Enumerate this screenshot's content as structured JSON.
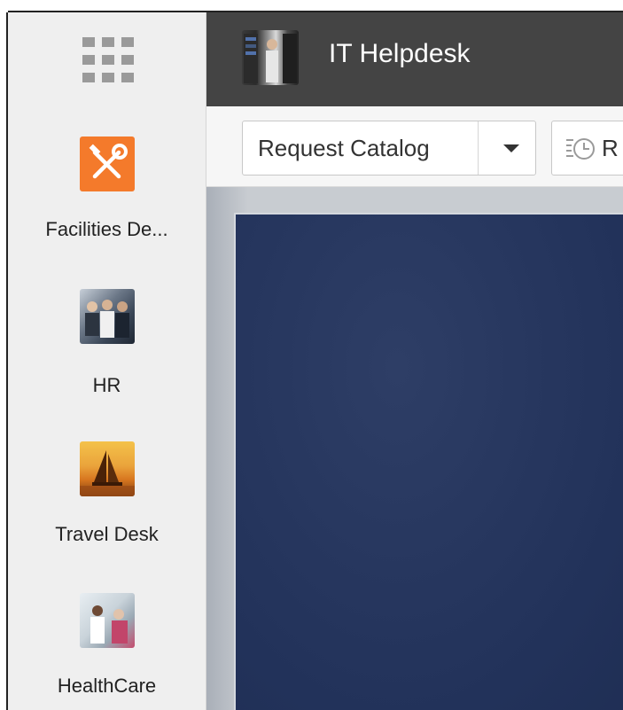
{
  "sidebar": {
    "apps": [
      {
        "label": "Facilities De...",
        "icon": "tools-icon"
      },
      {
        "label": "HR",
        "icon": "team-photo"
      },
      {
        "label": "Travel Desk",
        "icon": "sailboat-photo"
      },
      {
        "label": "HealthCare",
        "icon": "doctor-photo"
      }
    ]
  },
  "header": {
    "title": "IT Helpdesk"
  },
  "toolbar": {
    "catalog_select": "Request Catalog",
    "recent_label": "R"
  },
  "colors": {
    "header_bg": "#444444",
    "facilities_accent": "#f47a2b",
    "hero_bg": "#27375f"
  }
}
